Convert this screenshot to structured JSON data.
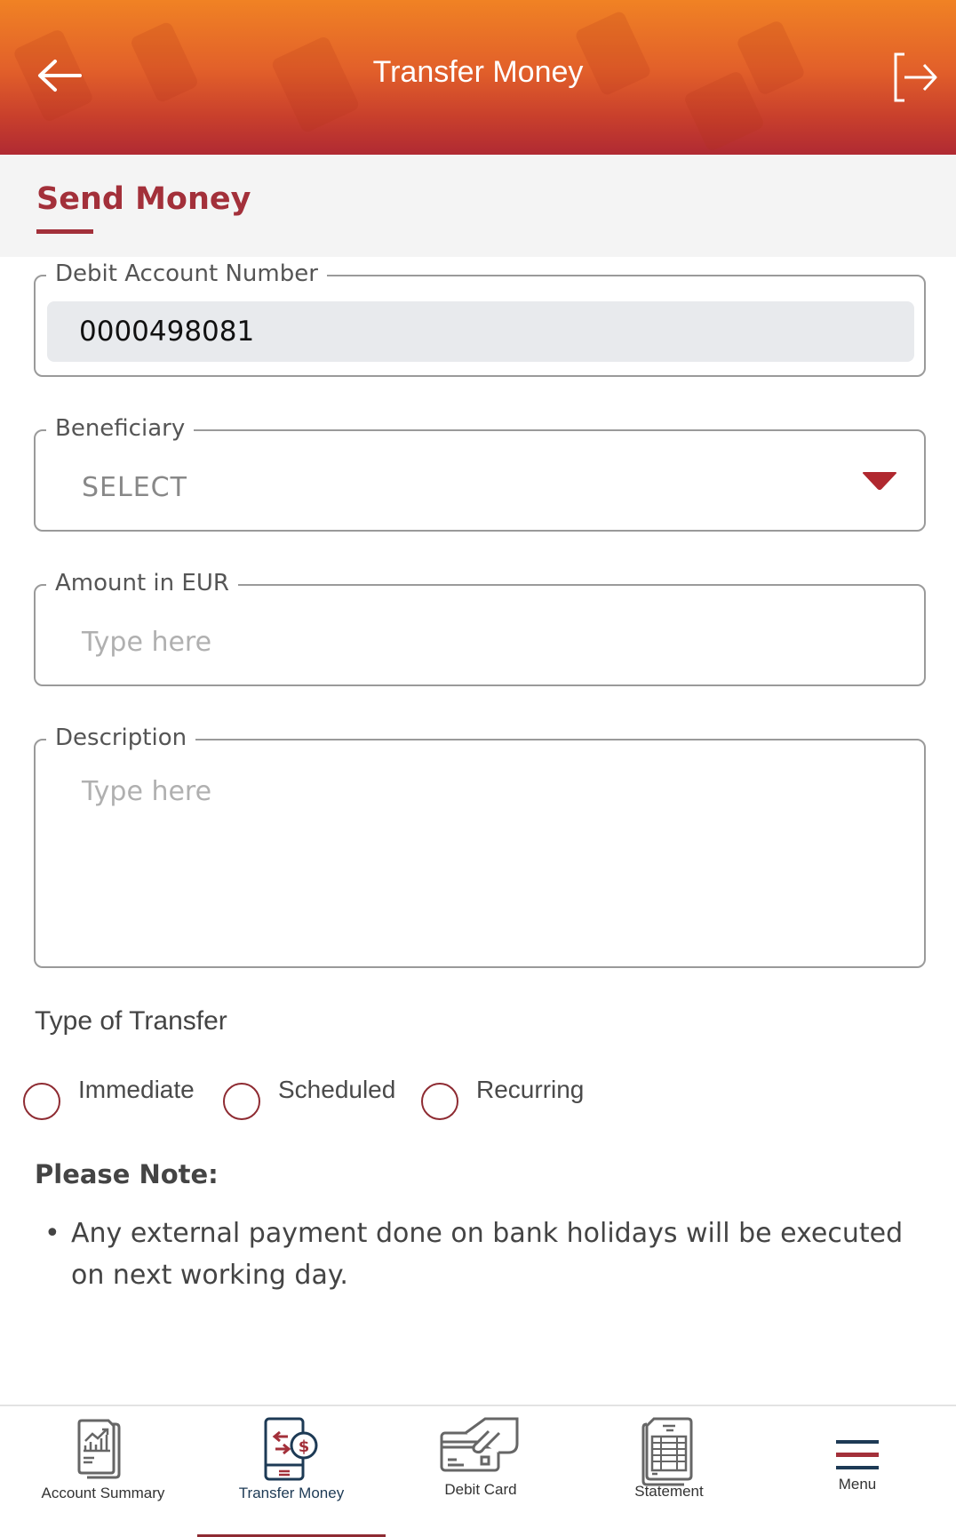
{
  "header": {
    "title": "Transfer Money",
    "back_icon": "arrow-left-icon",
    "logout_icon": "logout-icon",
    "gradient_top": "#f08224",
    "gradient_bottom": "#b02a33"
  },
  "tabs": [
    {
      "label": "Send Money",
      "active": true
    }
  ],
  "form": {
    "debit_account": {
      "label": "Debit Account Number",
      "value": "0000498081"
    },
    "beneficiary": {
      "label": "Beneficiary",
      "value": "SELECT"
    },
    "amount": {
      "label": "Amount in EUR",
      "placeholder": "Type here"
    },
    "description": {
      "label": "Description",
      "placeholder": "Type here"
    }
  },
  "transfer_type": {
    "title": "Type of Transfer",
    "options": [
      {
        "label": "Immediate",
        "selected": false
      },
      {
        "label": "Scheduled",
        "selected": false
      },
      {
        "label": "Recurring",
        "selected": false
      }
    ]
  },
  "note": {
    "title": "Please Note:",
    "items": [
      "Any external payment done on bank holidays will be executed on next working day."
    ]
  },
  "bottom_nav": {
    "items": [
      {
        "label": "Account Summary",
        "icon": "account-summary-icon",
        "active": false
      },
      {
        "label": "Transfer Money",
        "icon": "transfer-money-icon",
        "active": true
      },
      {
        "label": "Debit Card",
        "icon": "debit-card-icon",
        "active": false
      },
      {
        "label": "Statement",
        "icon": "statement-icon",
        "active": false
      },
      {
        "label": "Menu",
        "icon": "menu-icon",
        "active": false
      }
    ]
  },
  "colors": {
    "accent": "#a3303a",
    "navy": "#1d3a55",
    "field_border": "#9a9a9a"
  }
}
